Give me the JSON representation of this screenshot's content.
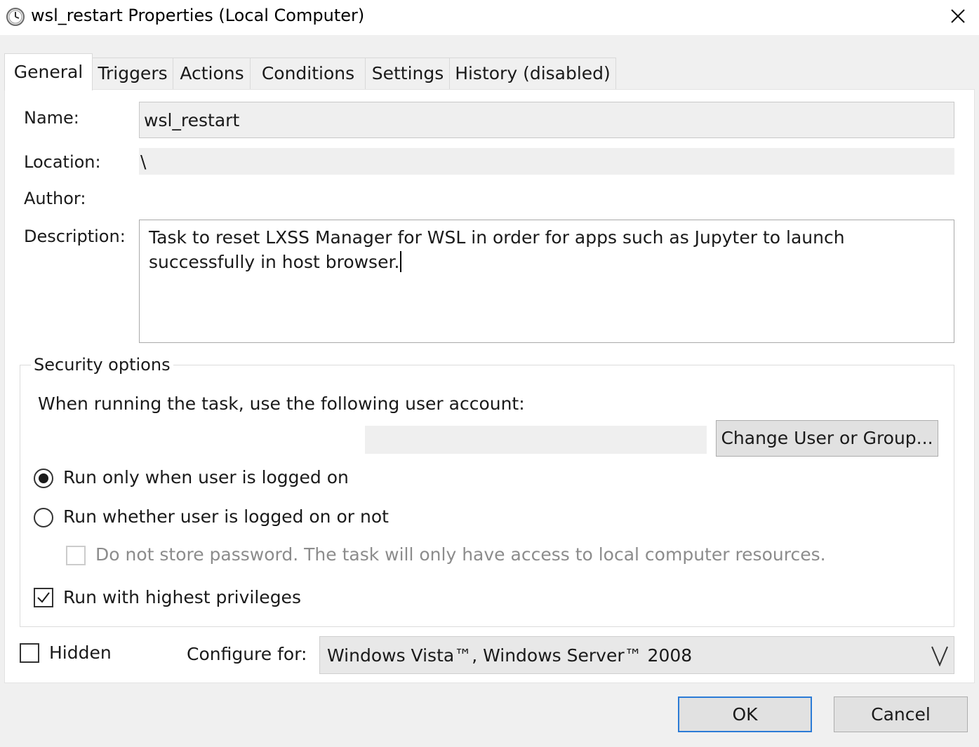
{
  "window": {
    "title": "wsl_restart Properties (Local Computer)",
    "icon": "clock-icon",
    "close_icon": "close-icon"
  },
  "tabs": [
    {
      "label": "General",
      "active": true
    },
    {
      "label": "Triggers",
      "active": false
    },
    {
      "label": "Actions",
      "active": false
    },
    {
      "label": "Conditions",
      "active": false
    },
    {
      "label": "Settings",
      "active": false
    },
    {
      "label": "History (disabled)",
      "active": false
    }
  ],
  "general": {
    "name_label": "Name:",
    "name_value": "wsl_restart",
    "location_label": "Location:",
    "location_value": "\\",
    "author_label": "Author:",
    "author_value": "",
    "description_label": "Description:",
    "description_value": "Task to reset LXSS Manager for WSL in order for apps such as Jupyter to launch successfully in host browser."
  },
  "security": {
    "title": "Security options",
    "account_prompt": "When running the task, use the following user account:",
    "account_value": "",
    "change_user_button": "Change User or Group...",
    "run_logged_on": {
      "label": "Run only when user is logged on",
      "selected": true
    },
    "run_whether": {
      "label": "Run whether user is logged on or not",
      "selected": false
    },
    "no_store_password": {
      "label": "Do not store password.  The task will only have access to local computer resources.",
      "checked": false,
      "enabled": false
    },
    "highest_privileges": {
      "label": "Run with highest privileges",
      "checked": true
    }
  },
  "bottom": {
    "hidden": {
      "label": "Hidden",
      "checked": false
    },
    "configure_label": "Configure for:",
    "configure_value": "Windows Vista™, Windows Server™ 2008"
  },
  "buttons": {
    "ok": "OK",
    "cancel": "Cancel"
  }
}
